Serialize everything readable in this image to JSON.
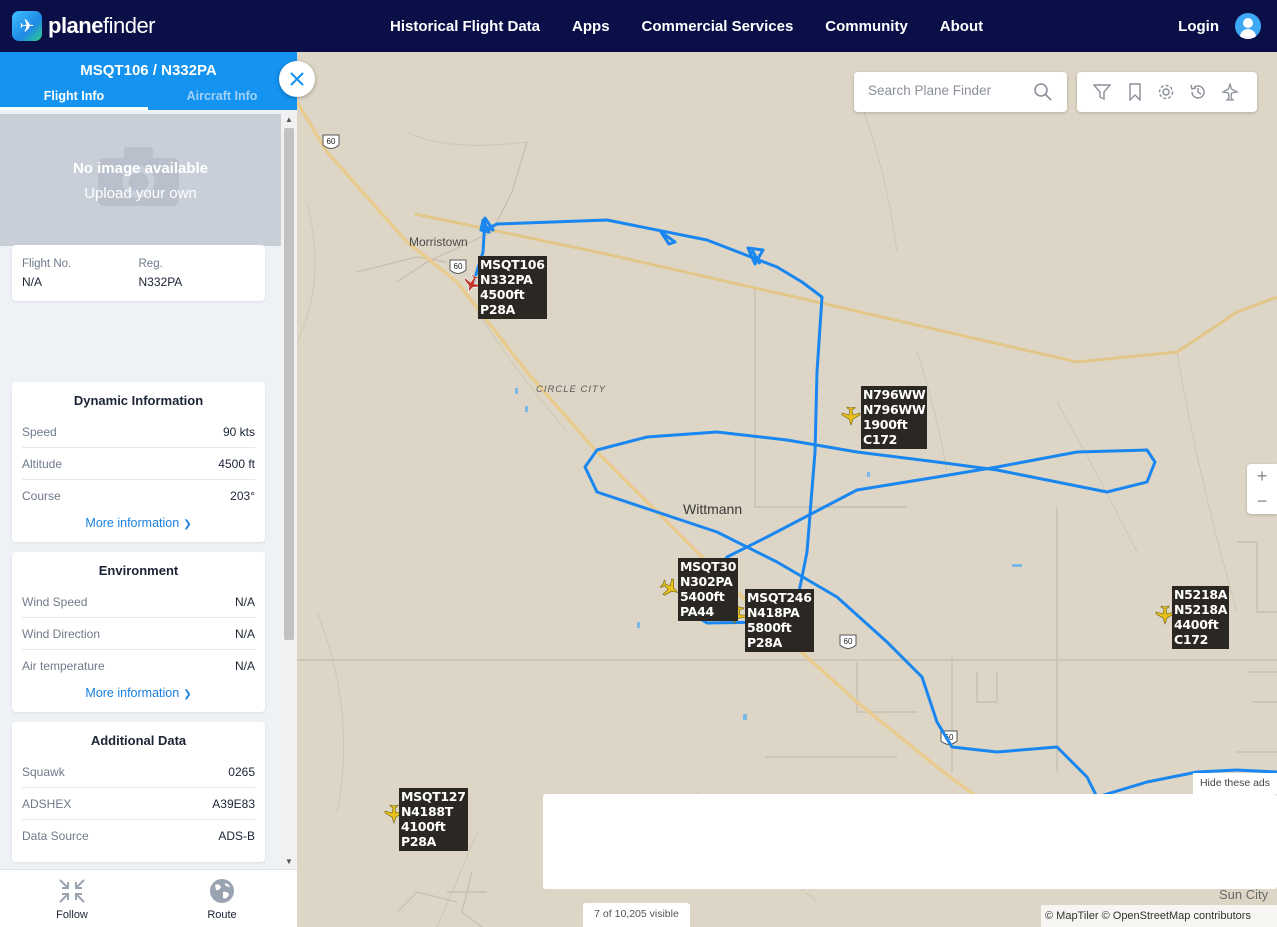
{
  "brand": {
    "name_bold": "plane",
    "name_light": "finder"
  },
  "nav": {
    "items": [
      "Historical Flight Data",
      "Apps",
      "Commercial Services",
      "Community",
      "About"
    ],
    "login": "Login"
  },
  "panel": {
    "title": "MSQT106 / N332PA",
    "tabs": [
      "Flight Info",
      "Aircraft Info"
    ],
    "photo": {
      "line1": "No image available",
      "line2": "Upload your own"
    },
    "flight": {
      "flight_no_label": "Flight No.",
      "flight_no": "N/A",
      "reg_label": "Reg.",
      "reg": "N332PA"
    },
    "dynamic": {
      "title": "Dynamic Information",
      "rows": [
        [
          "Speed",
          "90 kts"
        ],
        [
          "Altitude",
          "4500 ft"
        ],
        [
          "Course",
          "203°"
        ]
      ],
      "more": "More information"
    },
    "environment": {
      "title": "Environment",
      "rows": [
        [
          "Wind Speed",
          "N/A"
        ],
        [
          "Wind Direction",
          "N/A"
        ],
        [
          "Air temperature",
          "N/A"
        ]
      ],
      "more": "More information"
    },
    "additional": {
      "title": "Additional Data",
      "rows": [
        [
          "Squawk",
          "0265"
        ],
        [
          "ADSHEX",
          "A39E83"
        ],
        [
          "Data Source",
          "ADS-B"
        ]
      ]
    },
    "bottom": {
      "follow": "Follow",
      "route": "Route"
    }
  },
  "map": {
    "search_placeholder": "Search Plane Finder",
    "places": {
      "morristown": "Morristown",
      "circle_city": "CIRCLE CITY",
      "wittmann": "Wittmann",
      "sun_city": "Sun City"
    },
    "route_shield": "60",
    "aircraft": [
      {
        "lines": "MSQT106\nN332PA\n4500ft\nP28A",
        "selected": true
      },
      {
        "lines": "N796WW\nN796WW\n1900ft\nC172",
        "selected": false
      },
      {
        "lines": "MSQT30\nN302PA\n5400ft\nPA44",
        "selected": false
      },
      {
        "lines": "MSQT246\nN418PA\n5800ft\nP28A",
        "selected": false
      },
      {
        "lines": "N5218A\nN5218A\n4400ft\nC172",
        "selected": false
      },
      {
        "lines": "MSQT127\nN4188T\n4100ft\nP28A",
        "selected": false
      }
    ],
    "hide_ads": "Hide these ads",
    "visible_count": "7 of 10,205 visible",
    "attribution": "© MapTiler © OpenStreetMap contributors",
    "zoom_in": "+",
    "zoom_out": "−"
  },
  "colors": {
    "nav_bg": "#0b0f47",
    "accent": "#1493f0",
    "track": "#1a86f0",
    "map_bg": "#ddd6c6",
    "aircraft_yellow": "#e8c21a",
    "aircraft_selected": "#c0392b"
  }
}
